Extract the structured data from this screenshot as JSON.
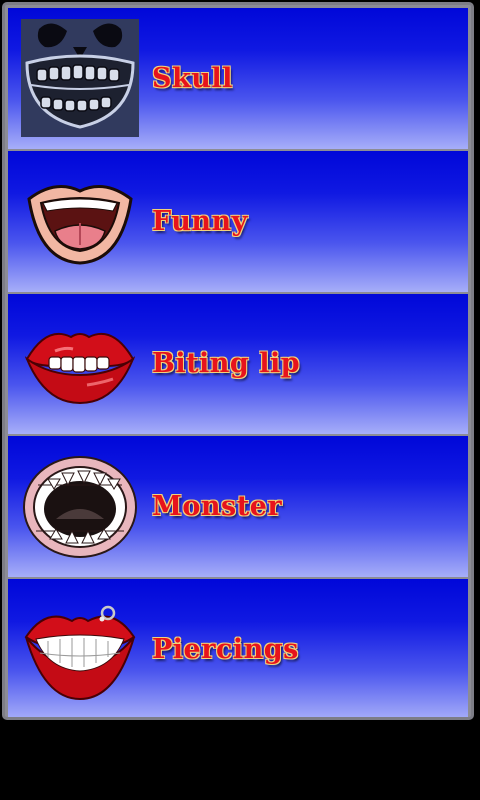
{
  "mouth_list": {
    "items": [
      {
        "label": "Skull",
        "icon": "skull-mouth-icon"
      },
      {
        "label": "Funny",
        "icon": "funny-mouth-icon"
      },
      {
        "label": "Biting lip",
        "icon": "biting-lip-mouth-icon"
      },
      {
        "label": "Monster",
        "icon": "monster-mouth-icon"
      },
      {
        "label": "Piercings",
        "icon": "pierced-lips-mouth-icon"
      }
    ]
  },
  "colors": {
    "label_text": "#e7131c",
    "label_outline": "#f2d27a",
    "row_top": "#0007d9",
    "row_bottom": "#a7aef9",
    "frame": "#8c8c95"
  }
}
